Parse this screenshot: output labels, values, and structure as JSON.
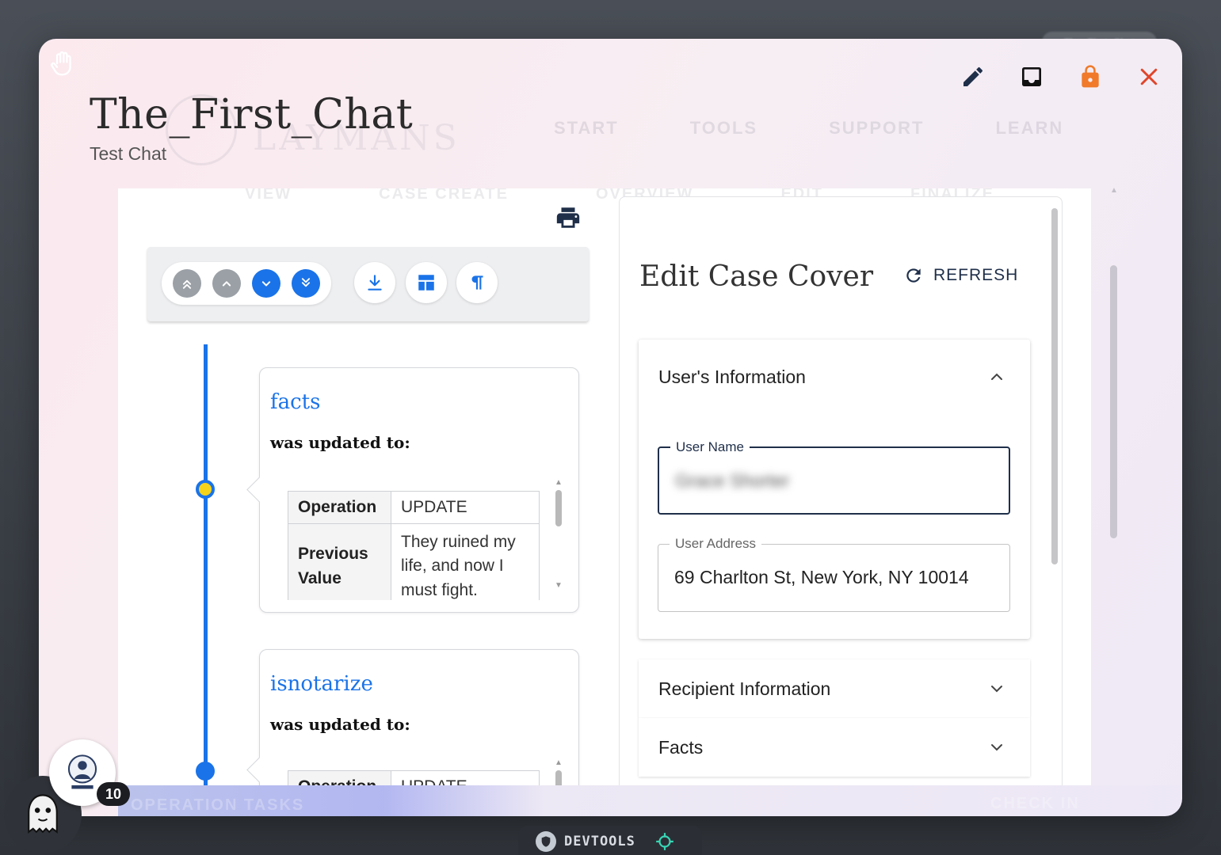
{
  "background": {
    "ghost_tab": "The_First_Chat",
    "ghost_nav": [
      "START",
      "TOOLS",
      "SUPPORT",
      "LEARN"
    ],
    "ghost_brand": "LAYMANS",
    "ghost_tabs": [
      "VIEW",
      "CASE CREATE",
      "OVERVIEW",
      "EDIT",
      "FINALIZE"
    ],
    "ghost_bottom_left": "OPERATION TASKS",
    "ghost_bottom_right": "CHECK IN"
  },
  "modal": {
    "title": "The_First_Chat",
    "subtitle": "Test Chat",
    "actions": [
      {
        "name": "edit",
        "icon": "pencil-icon",
        "color": "#1f2f4a"
      },
      {
        "name": "inbox",
        "icon": "inbox-icon",
        "color": "#111111"
      },
      {
        "name": "lock",
        "icon": "lock-icon",
        "color": "#f07a2a"
      },
      {
        "name": "close",
        "icon": "close-icon",
        "color": "#e0452a"
      }
    ]
  },
  "toolbar": {
    "nav_buttons": [
      {
        "icon": "double-chevron-up-icon",
        "color": "#9aa0a6"
      },
      {
        "icon": "chevron-up-icon",
        "color": "#9aa0a6"
      },
      {
        "icon": "chevron-down-icon",
        "color": "#1a73e8"
      },
      {
        "icon": "double-chevron-down-icon",
        "color": "#1a73e8"
      }
    ],
    "tools": [
      "download-icon",
      "layout-icon",
      "pilcrow-icon"
    ],
    "accent": "#1a73e8"
  },
  "timeline": {
    "entries": [
      {
        "field": "facts",
        "updated_text": "was updated to:",
        "node_color": "#f5d31a",
        "rows": [
          {
            "key": "Operation",
            "value": "UPDATE"
          },
          {
            "key": "Previous Value",
            "value": "They ruined my life, and now I must fight."
          }
        ]
      },
      {
        "field": "isnotarize",
        "updated_text": "was updated to:",
        "node_color": "#1a73e8",
        "rows": [
          {
            "key": "Operation",
            "value": "UPDATE"
          }
        ]
      }
    ]
  },
  "form": {
    "title": "Edit Case Cover",
    "refresh_label": "REFRESH",
    "sections": {
      "users_information": "User's Information",
      "recipient_information": "Recipient Information",
      "facts": "Facts"
    },
    "fields": {
      "user_name_label": "User Name",
      "user_name_value": "Grace Shorter",
      "user_address_label": "User Address",
      "user_address_value": "69 Charlton St, New York, NY 10014"
    }
  },
  "footer": {
    "badge_count": "10",
    "devtools_label": "DEVTOOLS"
  }
}
